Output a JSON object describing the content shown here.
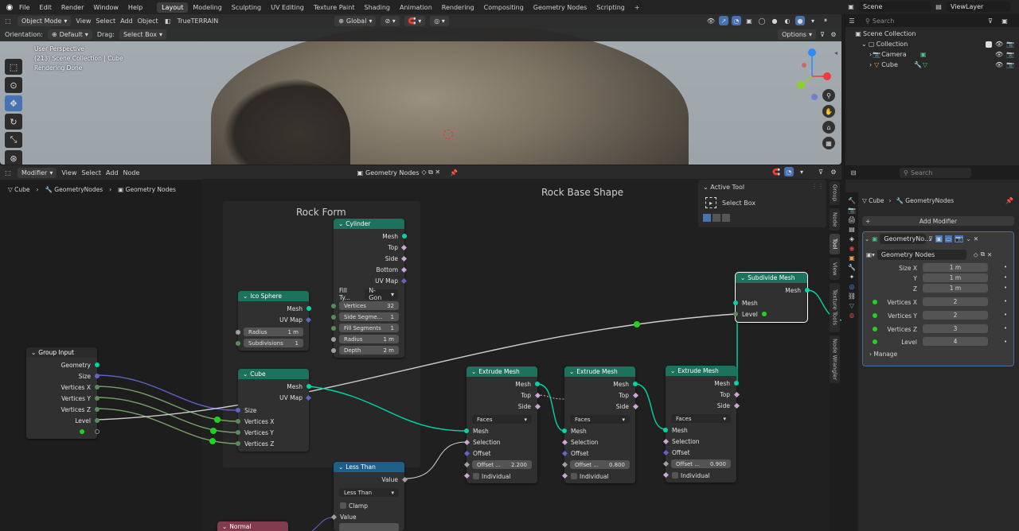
{
  "menu": [
    "File",
    "Edit",
    "Render",
    "Window",
    "Help"
  ],
  "workspaces": [
    "Layout",
    "Modeling",
    "Sculpting",
    "UV Editing",
    "Texture Paint",
    "Shading",
    "Animation",
    "Rendering",
    "Compositing",
    "Geometry Nodes",
    "Scripting"
  ],
  "top_right": {
    "scene": "Scene",
    "view_layer": "ViewLayer",
    "search_placeholder": "Search"
  },
  "viewport": {
    "mode": "Object Mode",
    "view": "View",
    "select": "Select",
    "add": "Add",
    "object": "Object",
    "addon": "TrueTERRAIN",
    "transform": "Global",
    "orientation_label": "Orientation:",
    "orientation": "Default",
    "drag_label": "Drag:",
    "drag": "Select Box",
    "options": "Options",
    "info": [
      "User Perspective",
      "(213) Scene Collection | Cube",
      "Rendering Done"
    ]
  },
  "outliner": {
    "scene_collection": "Scene Collection",
    "collection": "Collection",
    "items": [
      "Camera",
      "Cube"
    ]
  },
  "node_editor": {
    "editor_type": "Modifier",
    "view": "View",
    "select": "Select",
    "add": "Add",
    "node": "Node",
    "tree": "Geometry Nodes",
    "breadcrumb": [
      "Cube",
      "GeometryNodes",
      "Geometry Nodes"
    ],
    "frames": {
      "rock_base": "Rock Base Shape",
      "rock_form": "Rock Form"
    },
    "active_tool": {
      "title": "Active Tool",
      "tool": "Select Box"
    },
    "side_tabs": [
      "Group",
      "Node",
      "Tool",
      "View",
      "Texture Tools",
      "Node Wrangler"
    ],
    "group_input": {
      "title": "Group Input",
      "outputs": [
        "Geometry",
        "Size",
        "Vertices X",
        "Vertices Y",
        "Vertices Z",
        "Level"
      ]
    },
    "ico_sphere": {
      "title": "Ico Sphere",
      "outputs": [
        "Mesh",
        "UV Map"
      ],
      "radius_label": "Radius",
      "radius": "1 m",
      "subdiv_label": "Subdivisions",
      "subdiv": "1"
    },
    "cylinder": {
      "title": "Cylinder",
      "outputs": [
        "Mesh",
        "Top",
        "Side",
        "Bottom",
        "UV Map"
      ],
      "fill_label": "Fill Ty...",
      "fill": "N-Gon",
      "fields": [
        [
          "Vertices",
          "32"
        ],
        [
          "Side Segme...",
          "1"
        ],
        [
          "Fill Segments",
          "1"
        ],
        [
          "Radius",
          "1 m"
        ],
        [
          "Depth",
          "2 m"
        ]
      ]
    },
    "cube": {
      "title": "Cube",
      "outputs": [
        "Mesh",
        "UV Map"
      ],
      "inputs": [
        "Size",
        "Vertices X",
        "Vertices Y",
        "Vertices Z"
      ]
    },
    "extrude": [
      {
        "title": "Extrude Mesh",
        "mode": "Faces",
        "offset": "2.200"
      },
      {
        "title": "Extrude Mesh",
        "mode": "Faces",
        "offset": "0.800"
      },
      {
        "title": "Extrude Mesh",
        "mode": "Faces",
        "offset": "0.900"
      }
    ],
    "extrude_labels": {
      "outputs": [
        "Mesh",
        "Top",
        "Side"
      ],
      "inputs": [
        "Mesh",
        "Selection",
        "Offset"
      ],
      "offset_label": "Offset ...",
      "individual": "Individual"
    },
    "subdivide": {
      "title": "Subdivide Mesh",
      "output": "Mesh",
      "inputs": [
        "Mesh",
        "Level"
      ]
    },
    "less_than": {
      "title": "Less Than",
      "output": "Value",
      "op": "Less Than",
      "clamp": "Clamp",
      "input": "Value"
    },
    "normal": {
      "title": "Normal"
    }
  },
  "properties": {
    "object": "Cube",
    "modifier_path": "GeometryNodes",
    "add_modifier": "Add Modifier",
    "modifier_name": "GeometryNo...",
    "tree": "Geometry Nodes",
    "fields": [
      [
        "Size X",
        "1 m"
      ],
      [
        "Y",
        "1 m"
      ],
      [
        "Z",
        "1 m"
      ],
      [
        "Vertices X",
        "2"
      ],
      [
        "Vertices Y",
        "2"
      ],
      [
        "Vertices Z",
        "3"
      ],
      [
        "Level",
        "4"
      ]
    ],
    "manage": "Manage"
  },
  "colors": {
    "accent": "#4772b3",
    "geometry_header": "#1d725e",
    "math_header": "#1e5f87",
    "mesh_socket": "#00d6a3"
  }
}
